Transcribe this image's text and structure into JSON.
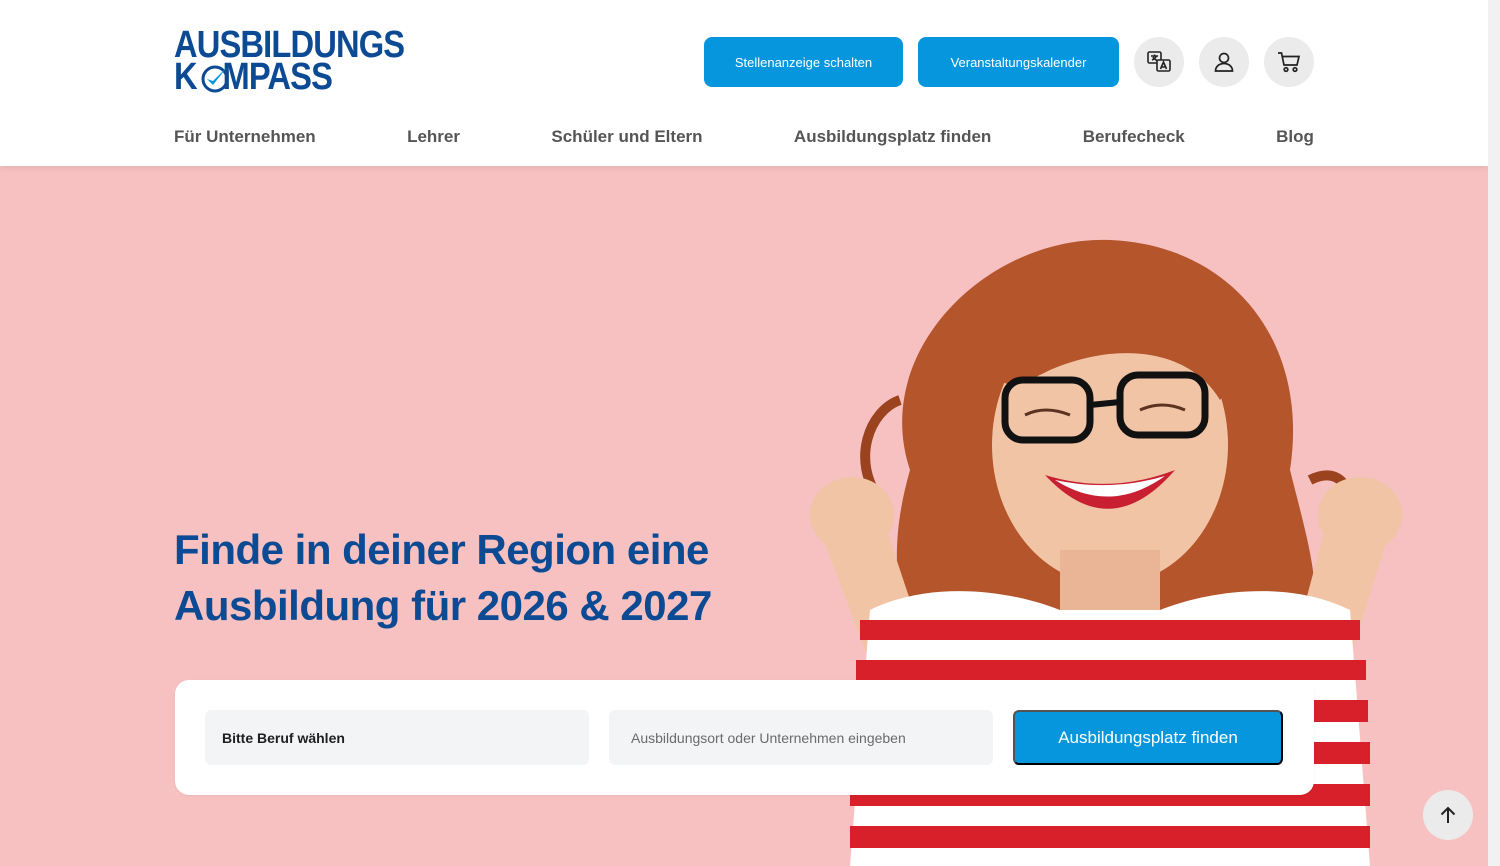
{
  "brand": {
    "line1": "AUSBILDUNGS",
    "line2_a": "K",
    "line2_b": "MPASS",
    "color": "#0c4a93"
  },
  "header": {
    "post_job_button": "Stellenanzeige schalten",
    "events_button": "Veranstaltungskalender",
    "icons": [
      "translate-icon",
      "user-icon",
      "cart-icon"
    ],
    "accent_color": "#0596de"
  },
  "nav": {
    "items": [
      {
        "label": "Für Unternehmen"
      },
      {
        "label": "Lehrer"
      },
      {
        "label": "Schüler und Eltern"
      },
      {
        "label": "Ausbildungsplatz finden"
      },
      {
        "label": "Berufecheck"
      },
      {
        "label": "Blog"
      }
    ]
  },
  "hero": {
    "headline_line1": "Finde in deiner Region eine",
    "headline_line2": "Ausbildung für 2026 & 2027",
    "background_color": "#f7c1c1"
  },
  "search": {
    "job_select_value": "Bitte Beruf wählen",
    "place_placeholder": "Ausbildungsort oder Unternehmen eingeben",
    "submit_label": "Ausbildungsplatz finden"
  },
  "scroll_top_icon": "arrow-up-icon"
}
